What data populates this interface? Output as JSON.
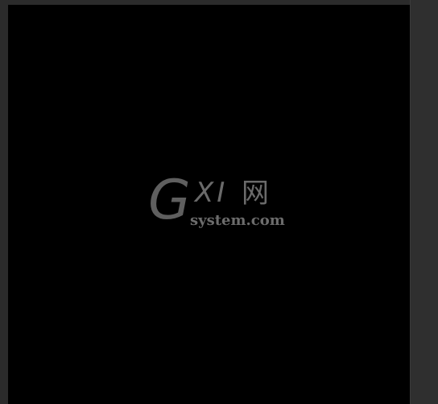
{
  "watermark": {
    "letter_g": "G",
    "letters_xi": "XI",
    "chinese_char": "网",
    "domain": "system.com"
  },
  "colors": {
    "workspace_bg": "#2b2b2b",
    "canvas_bg": "#000000",
    "watermark_gray": "#666666"
  }
}
